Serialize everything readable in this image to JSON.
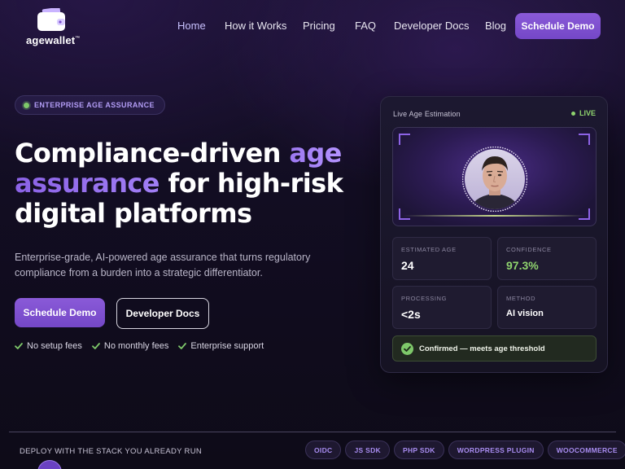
{
  "brand": {
    "name": "agewallet",
    "trademark": "™"
  },
  "nav": {
    "links": [
      {
        "label": "Home",
        "active": true
      },
      {
        "label": "How it Works",
        "active": false
      },
      {
        "label": "Pricing",
        "active": false
      },
      {
        "label": "FAQ",
        "active": false
      },
      {
        "label": "Developer Docs",
        "active": false
      },
      {
        "label": "Blog",
        "active": false
      }
    ],
    "cta": "Schedule Demo"
  },
  "hero": {
    "badge": "ENTERPRISE AGE ASSURANCE",
    "headline": {
      "part1": "Compliance-driven ",
      "accent1": "age",
      "accent2": "assurance",
      "part2": " for high-risk digital platforms"
    },
    "subtext": "Enterprise-grade, AI-powered age assurance that turns regulatory compliance from a burden into a strategic differentiator.",
    "primary_cta": "Schedule Demo",
    "secondary_cta": "Developer Docs",
    "features": [
      "No setup fees",
      "No monthly fees",
      "Enterprise support"
    ]
  },
  "card": {
    "title": "Live Age Estimation",
    "status": "LIVE",
    "stats": [
      {
        "label": "ESTIMATED AGE",
        "value": "24"
      },
      {
        "label": "CONFIDENCE",
        "value": "97.3%"
      },
      {
        "label": "PROCESSING",
        "value": "<2s"
      },
      {
        "label": "METHOD",
        "value": "AI vision"
      }
    ],
    "confirmation": "Confirmed — meets age threshold"
  },
  "footer": {
    "deploy_text": "DEPLOY WITH THE STACK YOU ALREADY RUN",
    "integrations": [
      "OIDC",
      "JS SDK",
      "PHP SDK",
      "WORDPRESS PLUGIN",
      "WOOCOMMERCE"
    ]
  },
  "colors": {
    "accent": "#7c4fd0",
    "accent_text": "#a88cf0",
    "success": "#8fd46e",
    "background": "#120d22"
  }
}
